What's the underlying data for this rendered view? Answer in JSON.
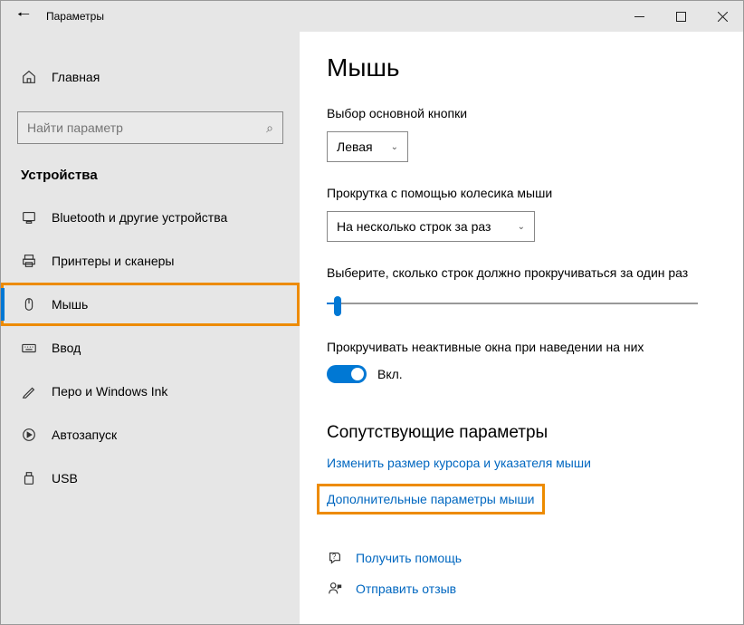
{
  "window": {
    "title": "Параметры"
  },
  "sidebar": {
    "home_label": "Главная",
    "search_placeholder": "Найти параметр",
    "section_label": "Устройства",
    "items": [
      {
        "label": "Bluetooth и другие устройства"
      },
      {
        "label": "Принтеры и сканеры"
      },
      {
        "label": "Мышь",
        "active": true
      },
      {
        "label": "Ввод"
      },
      {
        "label": "Перо и Windows Ink"
      },
      {
        "label": "Автозапуск"
      },
      {
        "label": "USB"
      }
    ]
  },
  "main": {
    "title": "Мышь",
    "primary_button_label": "Выбор основной кнопки",
    "primary_button_value": "Левая",
    "scroll_wheel_label": "Прокрутка с помощью колесика мыши",
    "scroll_wheel_value": "На несколько строк за раз",
    "lines_label": "Выберите, сколько строк должно прокручиваться за один раз",
    "inactive_label": "Прокручивать неактивные окна при наведении на них",
    "toggle_state": "Вкл.",
    "related_header": "Сопутствующие параметры",
    "link_cursor": "Изменить размер курсора и указателя мыши",
    "link_advanced": "Дополнительные параметры мыши",
    "help_get": "Получить помощь",
    "help_feedback": "Отправить отзыв"
  }
}
